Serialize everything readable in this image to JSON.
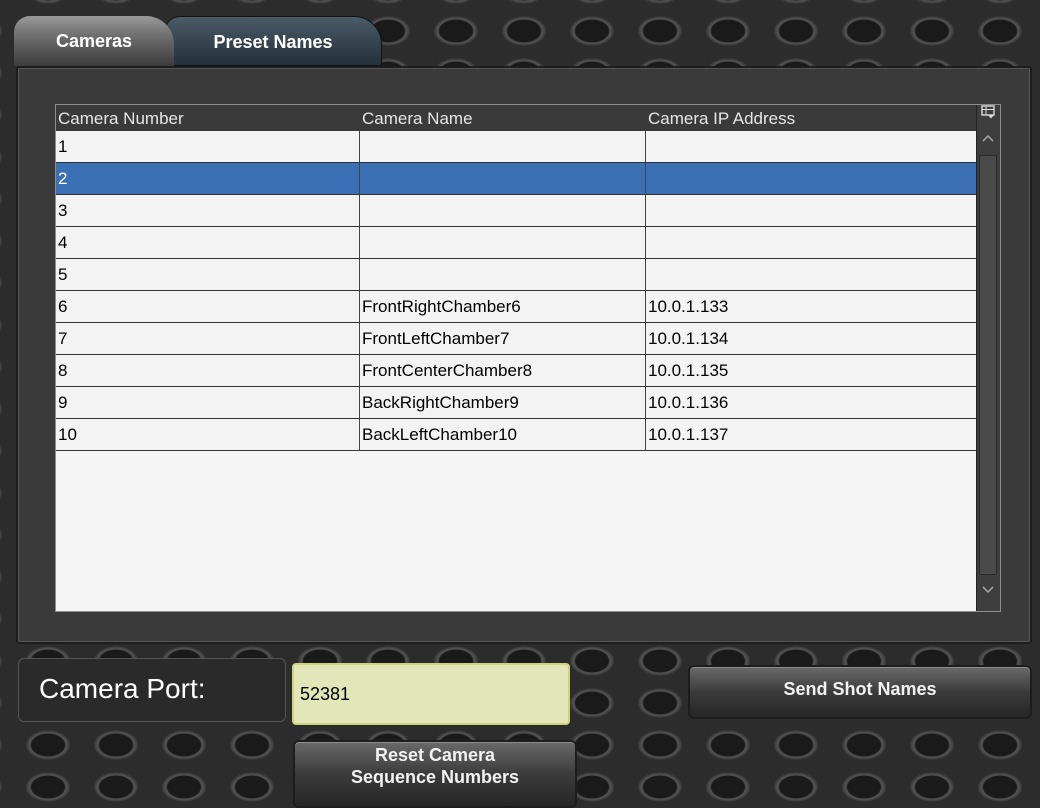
{
  "tabs": {
    "cameras": "Cameras",
    "preset_names": "Preset Names"
  },
  "grid": {
    "columns": [
      "Camera Number",
      "Camera Name",
      "Camera IP Address"
    ],
    "rows": [
      {
        "number": "1",
        "name": "",
        "ip": ""
      },
      {
        "number": "2",
        "name": "",
        "ip": "",
        "selected": true
      },
      {
        "number": "3",
        "name": "",
        "ip": ""
      },
      {
        "number": "4",
        "name": "",
        "ip": ""
      },
      {
        "number": "5",
        "name": "",
        "ip": ""
      },
      {
        "number": "6",
        "name": "FrontRightChamber6",
        "ip": "10.0.1.133"
      },
      {
        "number": "7",
        "name": "FrontLeftChamber7",
        "ip": "10.0.1.134"
      },
      {
        "number": "8",
        "name": "FrontCenterChamber8",
        "ip": "10.0.1.135"
      },
      {
        "number": "9",
        "name": "BackRightChamber9",
        "ip": "10.0.1.136"
      },
      {
        "number": "10",
        "name": "BackLeftChamber10",
        "ip": "10.0.1.137"
      }
    ]
  },
  "port": {
    "label": "Camera Port:",
    "value": "52381"
  },
  "buttons": {
    "send_shot_names": "Send Shot Names",
    "reset_line1": "Reset Camera",
    "reset_line2": "Sequence Numbers"
  },
  "colors": {
    "selected_row": "#3b70b6",
    "port_field": "#e3e6b8"
  },
  "icons": {
    "column_chooser": "column-chooser-icon",
    "scroll_up": "chevron-up-icon",
    "scroll_down": "chevron-down-icon"
  }
}
